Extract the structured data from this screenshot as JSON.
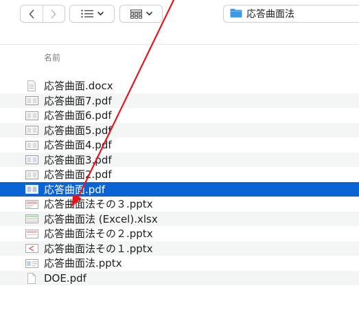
{
  "toolbar": {
    "back_icon": "chevron-left-icon",
    "forward_icon": "chevron-right-icon",
    "list_view_icon": "list-icon",
    "grid_view_icon": "grid-icon",
    "path_folder_icon": "folder-icon",
    "path_title": "応答曲面法"
  },
  "columns": {
    "name_header": "名前"
  },
  "files": [
    {
      "name": "応答曲面.docx",
      "icon": "docx-file-icon"
    },
    {
      "name": "応答曲面7.pdf",
      "icon": "pdf-file-icon"
    },
    {
      "name": "応答曲面6.pdf",
      "icon": "pdf-file-icon"
    },
    {
      "name": "応答曲面5.pdf",
      "icon": "pdf-file-icon"
    },
    {
      "name": "応答曲面4.pdf",
      "icon": "pdf-file-icon"
    },
    {
      "name": "応答曲面3.pdf",
      "icon": "pdf-file-icon"
    },
    {
      "name": "応答曲面2.pdf",
      "icon": "pdf-file-icon"
    },
    {
      "name": "応答曲面.pdf",
      "icon": "pdf-file-icon",
      "selected": true
    },
    {
      "name": "応答曲面法その３.pptx",
      "icon": "pptx-file-icon"
    },
    {
      "name": "応答曲面法 (Excel).xlsx",
      "icon": "xlsx-file-icon"
    },
    {
      "name": "応答曲面法その２.pptx",
      "icon": "pptx-file-icon"
    },
    {
      "name": "応答曲面法その１.pptx",
      "icon": "pptx-file-icon"
    },
    {
      "name": "応答曲面法.pptx",
      "icon": "pptx-file-icon"
    },
    {
      "name": "DOE.pdf",
      "icon": "blank-file-icon"
    }
  ],
  "colors": {
    "selection": "#0a64d6",
    "stripe": "#f4f5f5",
    "annotation_arrow": "#e8141b",
    "folder": "#3a9ae8"
  }
}
